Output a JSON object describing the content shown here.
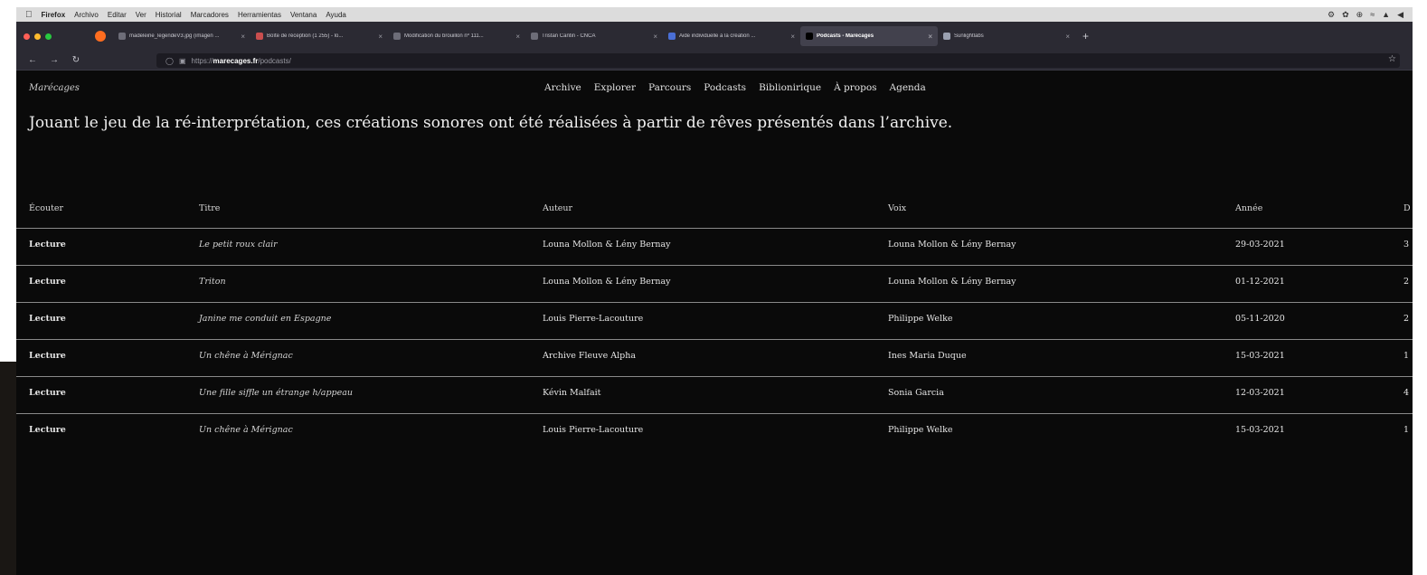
{
  "os_menu": {
    "items": [
      "Firefox",
      "Archivo",
      "Editar",
      "Ver",
      "Historial",
      "Marcadores",
      "Herramientas",
      "Ventana",
      "Ayuda"
    ]
  },
  "browser": {
    "tabs": [
      {
        "label": "madeleine_legendeV3.jpg (imagen ...",
        "active": false
      },
      {
        "label": "Boîte de réception (1 255) - lo...",
        "active": false
      },
      {
        "label": "Modification du brouillon nº 111...",
        "active": false
      },
      {
        "label": "Tristan Cantin - CNCA",
        "active": false
      },
      {
        "label": "Aide individuelle à la création ...",
        "active": false
      },
      {
        "label": "Podcasts - Marécages",
        "active": true
      },
      {
        "label": "Sunlightlabs",
        "active": false
      }
    ],
    "url_prefix": "https://",
    "url_host": "marecages.fr",
    "url_path": "/podcasts/"
  },
  "site": {
    "title": "Marécages",
    "nav": [
      "Archive",
      "Explorer",
      "Parcours",
      "Podcasts",
      "Biblionirique",
      "À propos",
      "Agenda"
    ],
    "intro": "Jouant le jeu de la ré-interprétation, ces créations sonores ont été réalisées à partir de rêves présentés dans l’archive."
  },
  "table": {
    "headers": [
      "Écouter",
      "Titre",
      "Auteur",
      "Voix",
      "Année",
      "D"
    ],
    "rows": [
      {
        "play": "Lecture",
        "title": "Le petit roux clair",
        "author": "Louna Mollon & Lény Bernay",
        "voice": "Louna Mollon & Lény Bernay",
        "year": "29-03-2021",
        "extra": "3"
      },
      {
        "play": "Lecture",
        "title": "Triton",
        "author": "Louna Mollon & Lény Bernay",
        "voice": "Louna Mollon & Lény Bernay",
        "year": "01-12-2021",
        "extra": "2"
      },
      {
        "play": "Lecture",
        "title": "Janine me conduit en Espagne",
        "author": "Louis Pierre-Lacouture",
        "voice": "Philippe Welke",
        "year": "05-11-2020",
        "extra": "2"
      },
      {
        "play": "Lecture",
        "title": "Un chêne à Mérignac",
        "author": "Archive Fleuve Alpha",
        "voice": "Ines Maria Duque",
        "year": "15-03-2021",
        "extra": "1"
      },
      {
        "play": "Lecture",
        "title": "Une fille siffle un étrange h/appeau",
        "author": "Kévin Malfait",
        "voice": "Sonia Garcia",
        "year": "12-03-2021",
        "extra": "4"
      },
      {
        "play": "Lecture",
        "title": "Un chêne à Mérignac",
        "author": "Louis Pierre-Lacouture",
        "voice": "Philippe Welke",
        "year": "15-03-2021",
        "extra": "1"
      }
    ]
  },
  "colors": {
    "page_bg": "#0a0a0a",
    "chrome_bg": "#2b2a33",
    "menubar_bg": "#dcdcdc",
    "traffic_red": "#ff5f57",
    "traffic_yellow": "#febc2e",
    "traffic_green": "#28c840"
  }
}
